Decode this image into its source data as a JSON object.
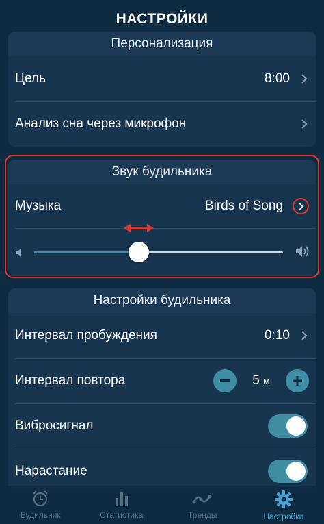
{
  "header": {
    "title": "НАСТРОЙКИ"
  },
  "personalization": {
    "header": "Персонализация",
    "goal_label": "Цель",
    "goal_value": "8:00",
    "mic_label": "Анализ сна через микрофон"
  },
  "alarm_sound": {
    "header": "Звук будильника",
    "music_label": "Музыка",
    "music_value": "Birds of Song",
    "volume_fraction": 0.42
  },
  "alarm_settings": {
    "header": "Настройки будильника",
    "wake_interval_label": "Интервал пробуждения",
    "wake_interval_value": "0:10",
    "snooze_label": "Интервал повтора",
    "snooze_value": "5",
    "snooze_unit": "м",
    "vibration_label": "Вибросигнал",
    "vibration_on": true,
    "fade_in_label": "Нарастание",
    "fade_in_on": true
  },
  "tabs": [
    {
      "label": "Будильник",
      "icon": "alarm-clock-icon",
      "active": false
    },
    {
      "label": "Статистика",
      "icon": "bar-chart-icon",
      "active": false
    },
    {
      "label": "Тренды",
      "icon": "trend-line-icon",
      "active": false
    },
    {
      "label": "Настройки",
      "icon": "gear-icon",
      "active": true
    }
  ],
  "colors": {
    "background": "#0f2b42",
    "accent": "#3f8ea3",
    "active_tab": "#4aa3d6",
    "highlight": "#e0392b"
  }
}
